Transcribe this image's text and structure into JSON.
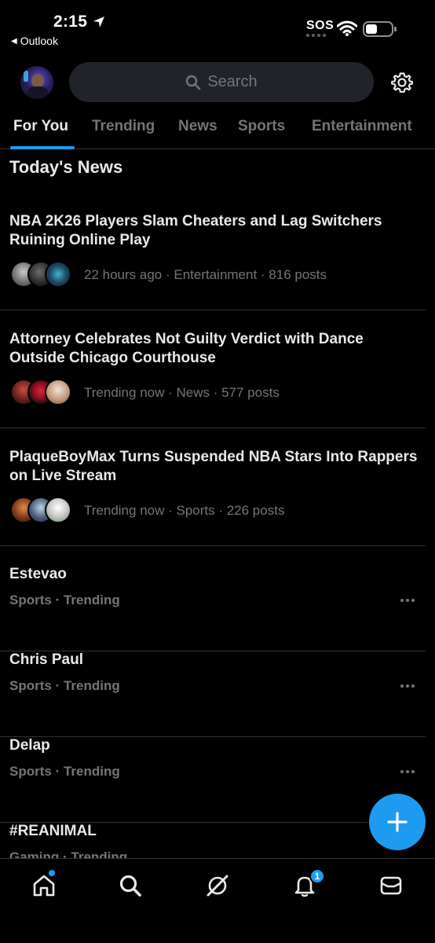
{
  "status_bar": {
    "time": "2:15",
    "back_app": "Outlook",
    "sos": "SOS"
  },
  "header": {
    "search_placeholder": "Search"
  },
  "tabs": [
    {
      "label": "For You",
      "active": true
    },
    {
      "label": "Trending",
      "active": false
    },
    {
      "label": "News",
      "active": false
    },
    {
      "label": "Sports",
      "active": false
    },
    {
      "label": "Entertainment",
      "active": false
    }
  ],
  "section_title": "Today's News",
  "news": [
    {
      "headline": "NBA 2K26 Players Slam Cheaters and Lag Switchers Ruining Online Play",
      "meta": "22 hours ago · Entertainment · 816 posts"
    },
    {
      "headline": "Attorney Celebrates Not Guilty Verdict with Dance Outside Chicago Courthouse",
      "meta": "Trending now · News · 577 posts"
    },
    {
      "headline": "PlaqueBoyMax Turns Suspended NBA Stars Into Rappers on Live Stream",
      "meta": "Trending now · Sports · 226 posts"
    }
  ],
  "trends": [
    {
      "name": "Estevao",
      "meta": "Sports · Trending"
    },
    {
      "name": "Chris Paul",
      "meta": "Sports · Trending"
    },
    {
      "name": "Delap",
      "meta": "Sports · Trending"
    },
    {
      "name": "#REANIMAL",
      "meta": "Gaming · Trending"
    }
  ],
  "nav": {
    "notifications_badge": "1"
  },
  "colors": {
    "accent": "#1d9bf0",
    "background": "#000000",
    "muted": "#71767b",
    "text": "#e7e9ea"
  }
}
